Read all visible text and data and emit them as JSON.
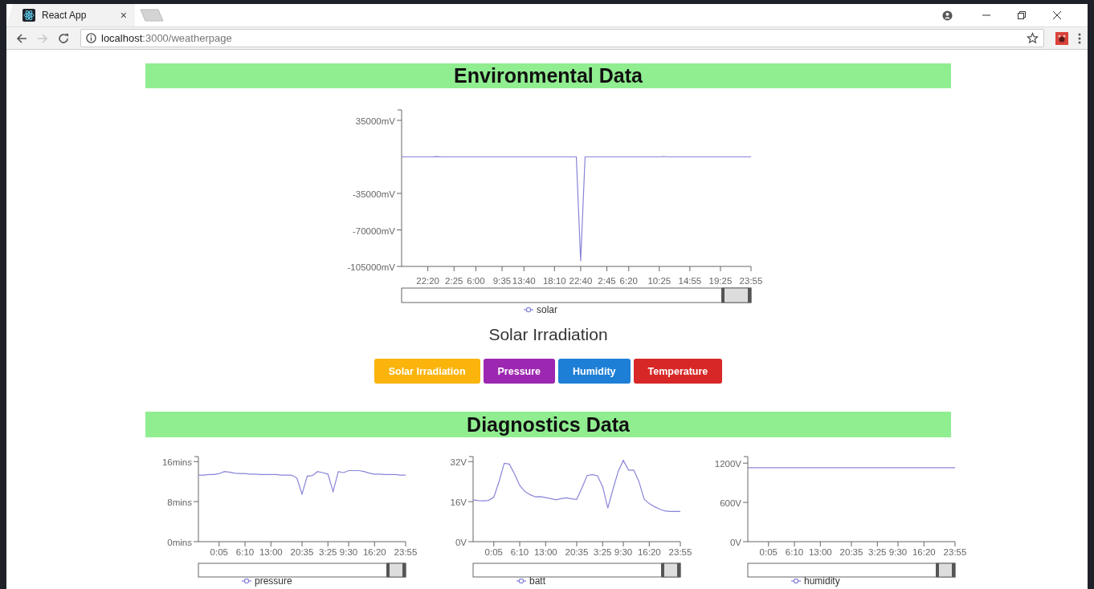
{
  "browser": {
    "tab_title": "React App",
    "tab_close": "×",
    "url_host": "localhost",
    "url_path": ":3000/weatherpage",
    "forward_disabled": true
  },
  "environmental": {
    "heading": "Environmental Data",
    "chart_data": {
      "type": "line",
      "categories": [
        null,
        null,
        null,
        null,
        null,
        null,
        "22:20",
        null,
        null,
        null,
        null,
        null,
        "2:25",
        null,
        null,
        null,
        null,
        "6:00",
        null,
        null,
        null,
        null,
        null,
        "9:35",
        null,
        null,
        null,
        null,
        "13:40",
        null,
        null,
        null,
        null,
        null,
        null,
        "18:10",
        null,
        null,
        null,
        null,
        null,
        "22:40",
        null,
        null,
        null,
        null,
        null,
        "2:45",
        null,
        null,
        null,
        null,
        "6:20",
        null,
        null,
        null,
        null,
        null,
        null,
        "10:25",
        null,
        null,
        null,
        null,
        null,
        null,
        "14:55",
        null,
        null,
        null,
        null,
        null,
        null,
        "19:25",
        null,
        null,
        null,
        null,
        null,
        null,
        "23:55"
      ],
      "series": [
        {
          "name": "solar",
          "color": "#8884d8",
          "values": [
            0,
            0,
            0,
            0,
            0,
            0,
            0,
            0,
            300,
            0,
            0,
            0,
            0,
            0,
            0,
            0,
            0,
            0,
            0,
            0,
            0,
            0,
            0,
            0,
            0,
            0,
            0,
            0,
            0,
            0,
            0,
            0,
            0,
            0,
            0,
            0,
            0,
            0,
            0,
            0,
            0,
            -100000,
            0,
            0,
            0,
            0,
            0,
            0,
            0,
            0,
            0,
            0,
            0,
            0,
            0,
            0,
            0,
            0,
            0,
            0,
            400,
            0,
            0,
            0,
            0,
            0,
            0,
            0,
            0,
            0,
            0,
            0,
            0,
            0,
            0,
            0,
            0,
            0,
            0,
            0,
            0
          ]
        }
      ],
      "ylim": [
        -105000,
        45000
      ],
      "yticks": [
        {
          "value": 35000,
          "label": "35000mV"
        },
        {
          "value": -35000,
          "label": "-35000mV"
        },
        {
          "value": -70000,
          "label": "-70000mV"
        },
        {
          "value": -105000,
          "label": "-105000mV"
        }
      ]
    },
    "chart_title": "Solar Irradiation",
    "buttons": [
      {
        "label": "Solar Irradiation",
        "color": "#fbb40c"
      },
      {
        "label": "Pressure",
        "color": "#9c27b0"
      },
      {
        "label": "Humidity",
        "color": "#1e7fd6"
      },
      {
        "label": "Temperature",
        "color": "#d72727"
      }
    ]
  },
  "diagnostics": {
    "heading": "Diagnostics Data",
    "charts": [
      {
        "chart_data": {
          "type": "line",
          "categories": [
            null,
            null,
            null,
            null,
            "0:05",
            null,
            null,
            null,
            null,
            "6:10",
            null,
            null,
            null,
            null,
            "13:00",
            null,
            null,
            null,
            null,
            null,
            "20:35",
            null,
            null,
            null,
            null,
            "3:25",
            null,
            null,
            null,
            "9:30",
            null,
            null,
            null,
            null,
            "16:20",
            null,
            null,
            null,
            null,
            null,
            "23:55"
          ],
          "series": [
            {
              "name": "pressure",
              "color": "#8884d8",
              "values": [
                13.3,
                13.3,
                13.4,
                13.4,
                13.6,
                14,
                13.9,
                13.7,
                13.6,
                13.6,
                13.5,
                13.5,
                13.4,
                13.4,
                13.4,
                13.4,
                13.3,
                13.3,
                13.3,
                12.7,
                9.5,
                13.1,
                13.2,
                14,
                13.8,
                13.5,
                10,
                14,
                13.8,
                14.2,
                14.2,
                14.2,
                14,
                13.7,
                13.5,
                13.5,
                13.4,
                13.4,
                13.4,
                13.3,
                13.3
              ]
            }
          ],
          "ylim": [
            0,
            17
          ],
          "yticks": [
            {
              "value": 0,
              "label": "0mins"
            },
            {
              "value": 8,
              "label": "8mins"
            },
            {
              "value": 16,
              "label": "16mins"
            }
          ]
        }
      },
      {
        "chart_data": {
          "type": "line",
          "categories": [
            null,
            null,
            null,
            null,
            "0:05",
            null,
            null,
            null,
            null,
            "6:10",
            null,
            null,
            null,
            null,
            "13:00",
            null,
            null,
            null,
            null,
            null,
            "20:35",
            null,
            null,
            null,
            null,
            "3:25",
            null,
            null,
            null,
            "9:30",
            null,
            null,
            null,
            null,
            "16:20",
            null,
            null,
            null,
            null,
            null,
            "23:55"
          ],
          "series": [
            {
              "name": "batt",
              "color": "#8884d8",
              "values": [
                16.7,
                16.4,
                16.3,
                16.5,
                17.8,
                24,
                31.3,
                31,
                27,
                22.5,
                20,
                18.8,
                17.9,
                18,
                17.6,
                17.2,
                16.7,
                17.2,
                17.5,
                17.1,
                16.9,
                21.5,
                26.4,
                26.8,
                26.3,
                22,
                13.4,
                21,
                28,
                32.5,
                28.6,
                28.6,
                24.1,
                17,
                15.2,
                14,
                13,
                12.3,
                12.1,
                12.1,
                12.1
              ]
            }
          ],
          "ylim": [
            0,
            34
          ],
          "yticks": [
            {
              "value": 0,
              "label": "0V"
            },
            {
              "value": 16,
              "label": "16V"
            },
            {
              "value": 32,
              "label": "32V"
            }
          ]
        }
      },
      {
        "chart_data": {
          "type": "line",
          "categories": [
            null,
            null,
            null,
            null,
            "0:05",
            null,
            null,
            null,
            null,
            "6:10",
            null,
            null,
            null,
            null,
            "13:00",
            null,
            null,
            null,
            null,
            null,
            "20:35",
            null,
            null,
            null,
            null,
            "3:25",
            null,
            null,
            null,
            "9:30",
            null,
            null,
            null,
            null,
            "16:20",
            null,
            null,
            null,
            null,
            null,
            "23:55"
          ],
          "series": [
            {
              "name": "humidity",
              "color": "#8884d8",
              "values": [
                1130,
                1130,
                1130,
                1130,
                1130,
                1130,
                1130,
                1130,
                1130,
                1130,
                1130,
                1130,
                1130,
                1130,
                1130,
                1130,
                1130,
                1130,
                1130,
                1130,
                1130,
                1130,
                1130,
                1130,
                1130,
                1130,
                1130,
                1130,
                1130,
                1130,
                1130,
                1130,
                1130,
                1130,
                1130,
                1130,
                1130,
                1130,
                1130,
                1130,
                1130
              ]
            }
          ],
          "ylim": [
            0,
            1300
          ],
          "yticks": [
            {
              "value": 0,
              "label": "0V"
            },
            {
              "value": 600,
              "label": "600V"
            },
            {
              "value": 1200,
              "label": "1200V"
            }
          ]
        }
      }
    ]
  }
}
